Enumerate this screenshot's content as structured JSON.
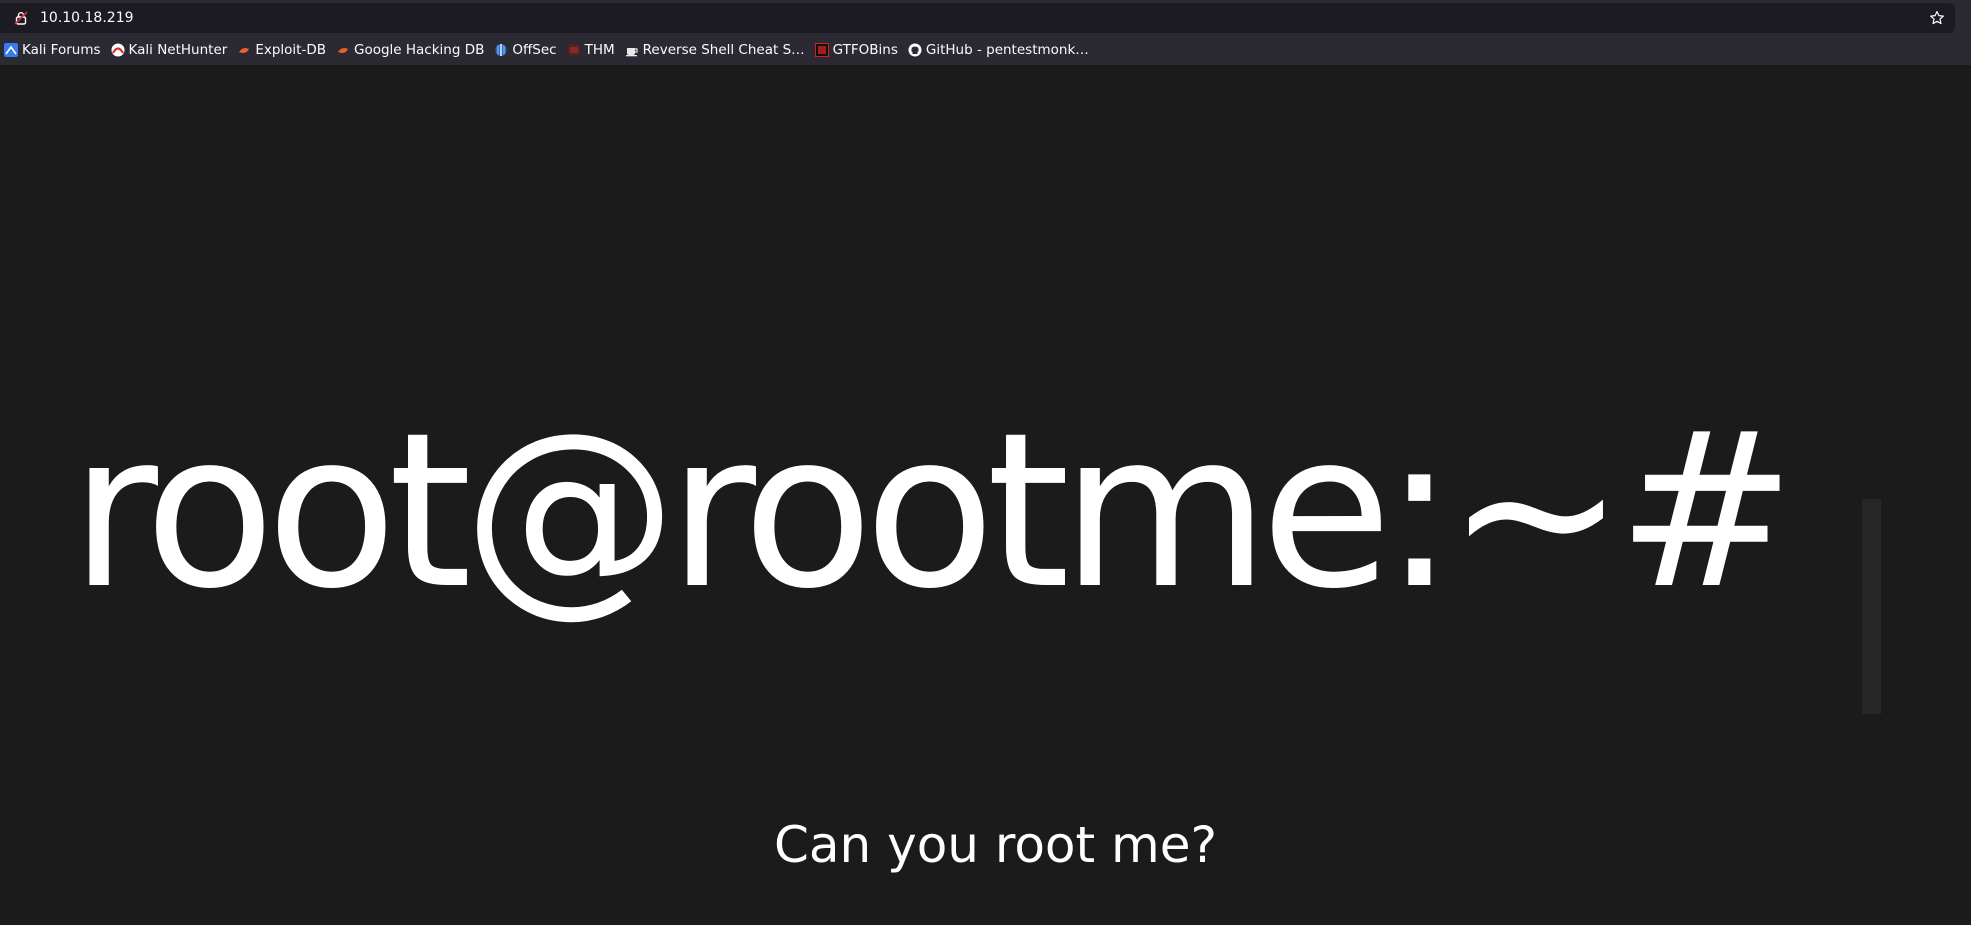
{
  "browser": {
    "url": "10.10.18.219",
    "bookmarks": [
      {
        "label": "Kali Forums",
        "icon": "kali-dragon-icon"
      },
      {
        "label": "Kali NetHunter",
        "icon": "nethunter-icon"
      },
      {
        "label": "Exploit-DB",
        "icon": "exploit-db-icon"
      },
      {
        "label": "Google Hacking DB",
        "icon": "ghdb-icon"
      },
      {
        "label": "OffSec",
        "icon": "offsec-icon"
      },
      {
        "label": "THM",
        "icon": "thm-icon"
      },
      {
        "label": "Reverse Shell Cheat S…",
        "icon": "coffee-cup-icon"
      },
      {
        "label": "GTFOBins",
        "icon": "gtfobins-icon"
      },
      {
        "label": "GitHub - pentestmonk…",
        "icon": "github-icon"
      }
    ]
  },
  "page": {
    "prompt": "root@rootme:~#",
    "tagline": "Can you root me?"
  },
  "colors": {
    "background": "#1b1b1b",
    "text": "#ffffff",
    "cursor": "#272727",
    "chrome": "#2b2a33",
    "urlbar": "#1c1b22"
  }
}
